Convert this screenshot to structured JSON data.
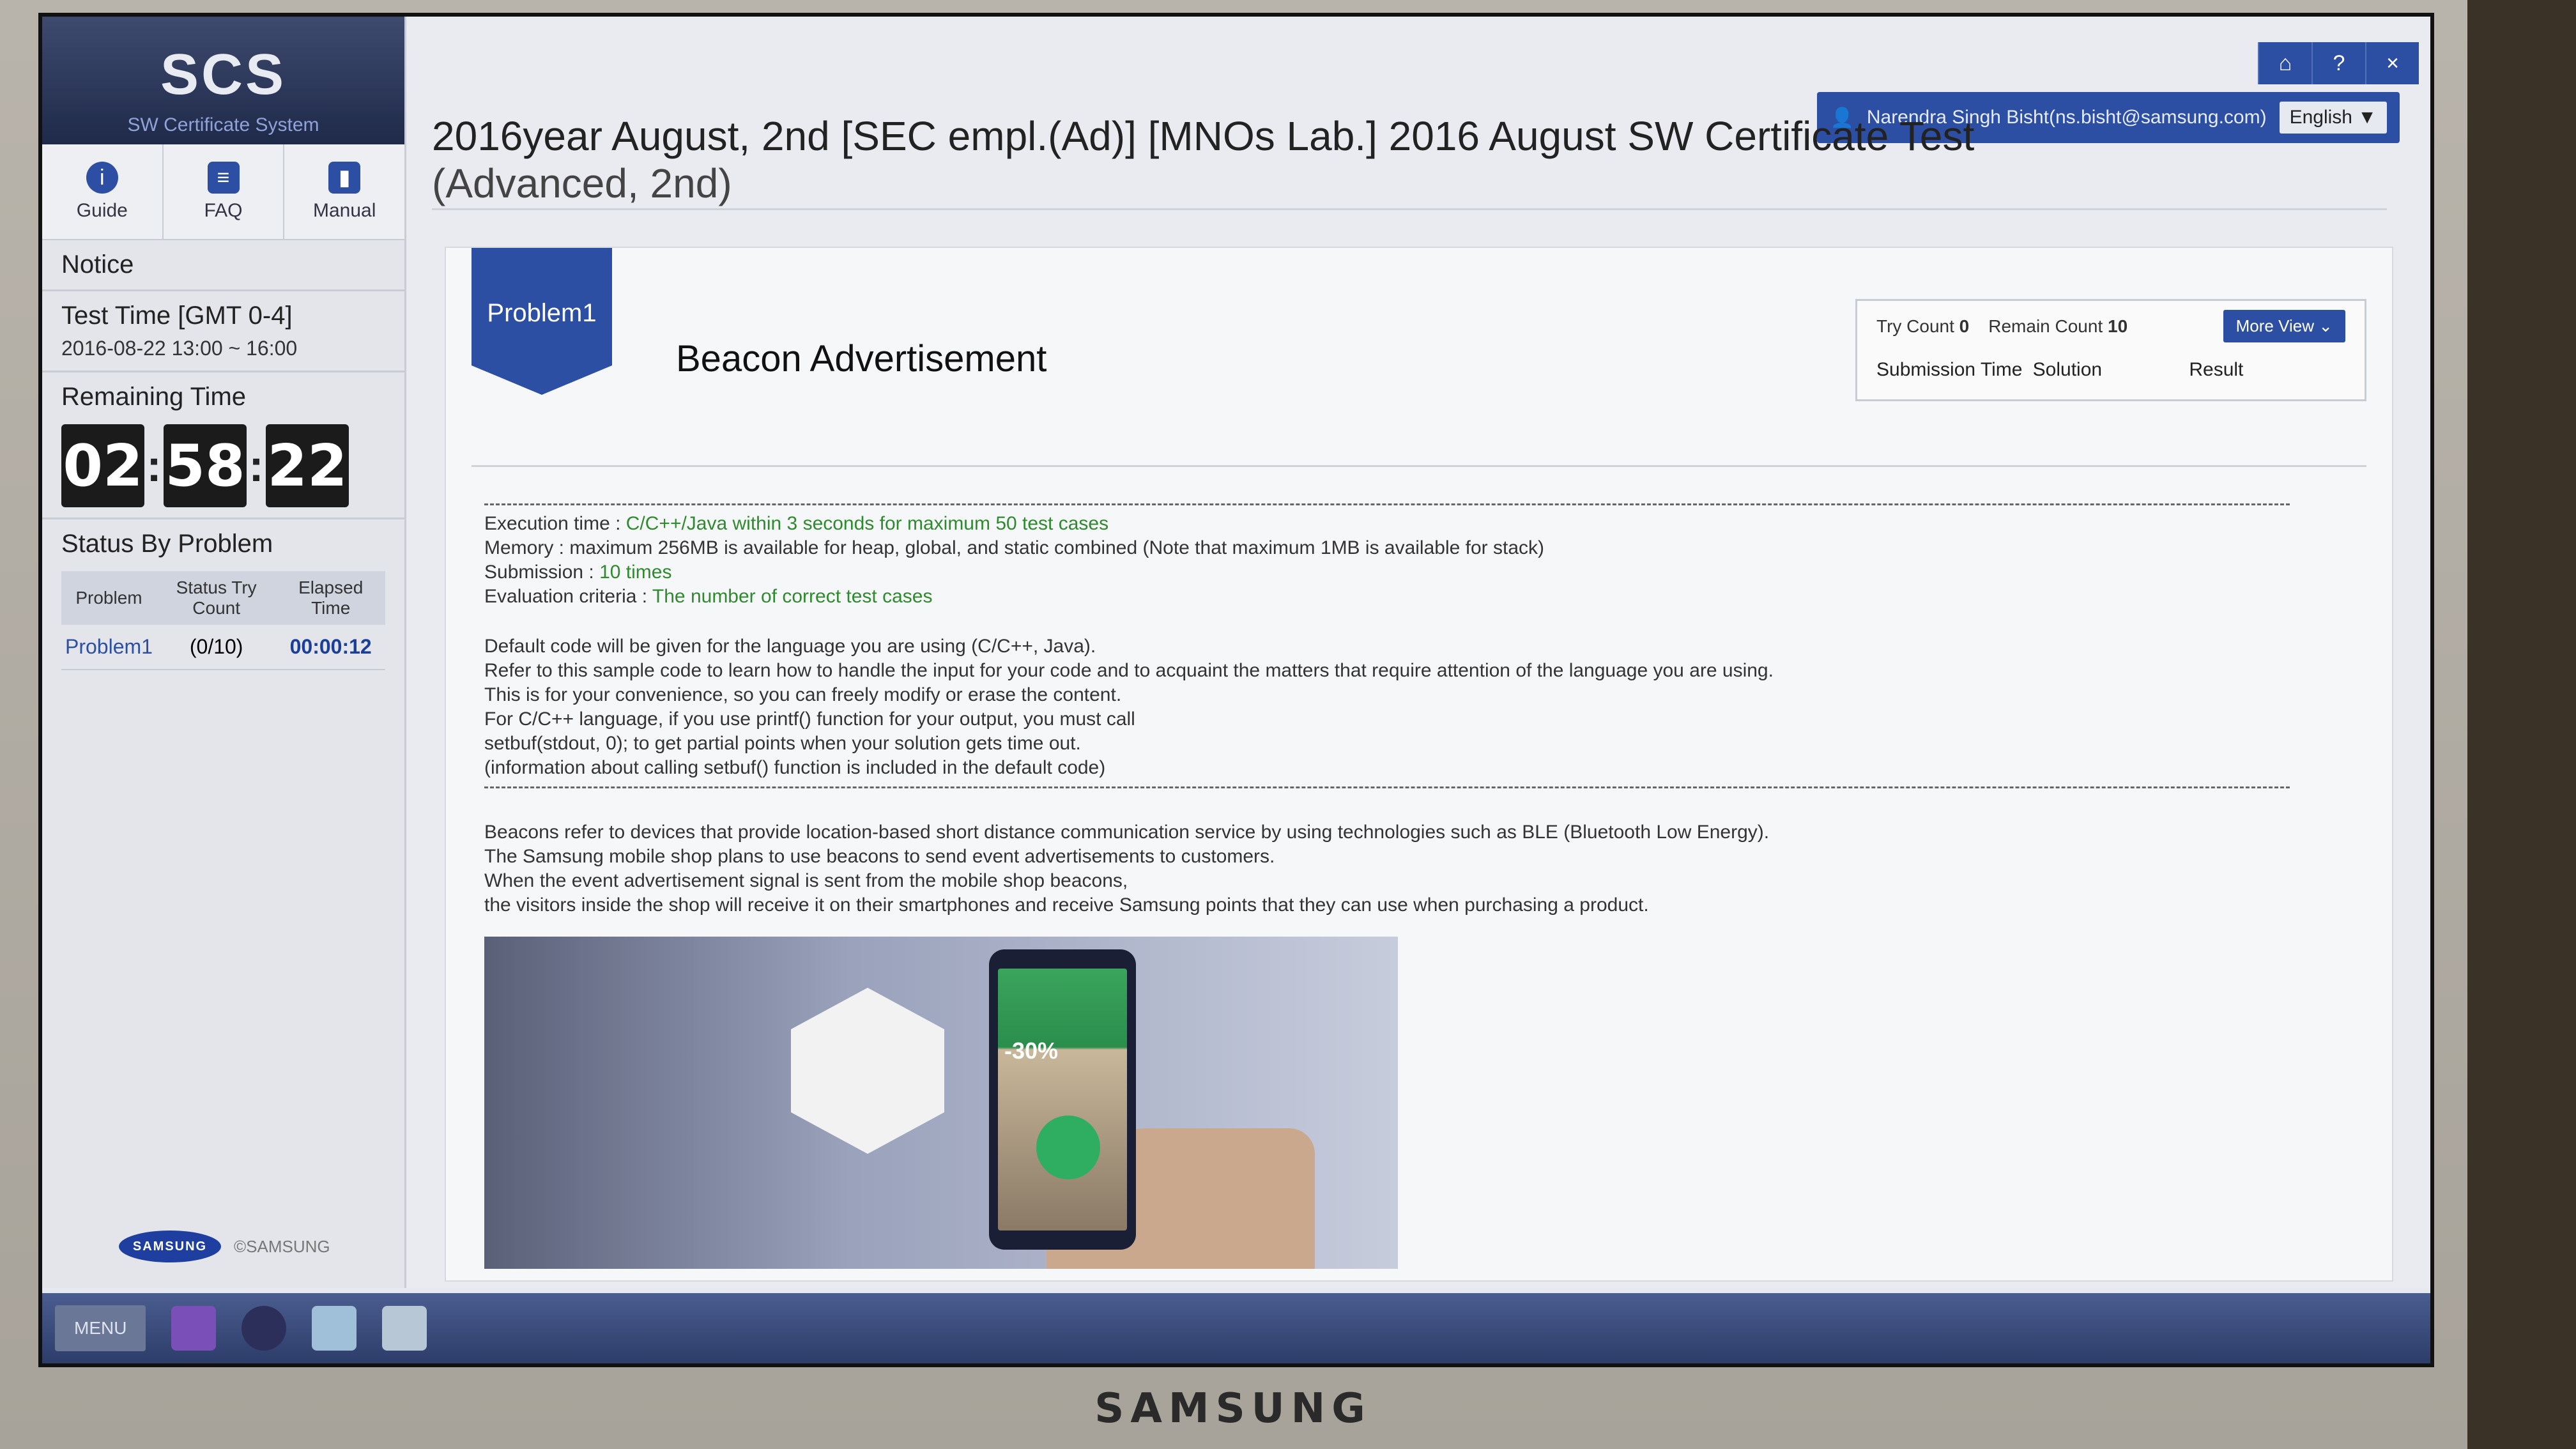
{
  "brand": "SAMSUNG",
  "logo": {
    "title": "SCS",
    "subtitle": "SW Certificate System"
  },
  "quick": {
    "guide": "Guide",
    "faq": "FAQ",
    "manual": "Manual"
  },
  "notice": "Notice",
  "test_time": {
    "label": "Test Time [GMT 0-4]",
    "value": "2016-08-22 13:00 ~ 16:00"
  },
  "remaining": {
    "label": "Remaining Time",
    "hh": "02",
    "mm": "58",
    "ss": "22"
  },
  "status": {
    "label": "Status By Problem",
    "headers": {
      "problem": "Problem",
      "status": "Status Try Count",
      "elapsed": "Elapsed Time"
    },
    "row": {
      "problem": "Problem1",
      "count": "(0/10)",
      "elapsed": "00:00:12"
    }
  },
  "sidefoot": {
    "logo": "SAMSUNG",
    "copy": "©SAMSUNG"
  },
  "window_buttons": {
    "home": "⌂",
    "help": "?",
    "close": "×"
  },
  "user": {
    "name": "Narendra Singh Bisht(ns.bisht@samsung.com)",
    "language": "English ▼"
  },
  "page_title": {
    "main": "2016year August, 2nd [SEC empl.(Ad)] [MNOs Lab.] 2016 August SW Certificate Test",
    "paren": "(Advanced, 2nd)"
  },
  "problem": {
    "ribbon": "Problem1",
    "title": "Beacon Advertisement",
    "try_label": "Try Count",
    "try_count": "0",
    "remain_label": "Remain Count",
    "remain_count": "10",
    "more_view": "More View ⌄",
    "cols": {
      "submission_time": "Submission Time",
      "solution": "Solution",
      "result": "Result"
    }
  },
  "rules": {
    "exec_label": "Execution time : ",
    "exec_val": "C/C++/Java within 3 seconds for maximum 50 test cases",
    "mem": "Memory : maximum 256MB is available for heap, global, and static combined (Note that maximum 1MB is available for stack)",
    "sub_label": "Submission : ",
    "sub_val": "10 times",
    "eval_label": "Evaluation criteria : ",
    "eval_val": "The number of correct test cases"
  },
  "default_code": [
    "Default code will be given for the language you are using (C/C++, Java).",
    "Refer to this sample code to learn how to handle the input for your code and to acquaint the matters that require attention of the language you are using.",
    "This is for your convenience, so you can freely modify or erase the content.",
    " For C/C++ language, if you use printf() function for your output, you must call",
    "setbuf(stdout, 0); to get partial points when your solution gets time out.",
    "(information about calling setbuf() function is included in the default code)"
  ],
  "description": [
    "Beacons refer to devices that provide location-based short distance communication service by using technologies such as BLE (Bluetooth Low Energy).",
    "The Samsung mobile shop plans to use beacons to send event advertisements to customers.",
    "When the event advertisement signal is sent from the mobile shop beacons,",
    "the visitors inside the shop will receive it on their smartphones and receive Samsung points that they can use when purchasing a product."
  ],
  "illus": {
    "discount": "-30%"
  },
  "taskbar": {
    "menu": "MENU"
  }
}
